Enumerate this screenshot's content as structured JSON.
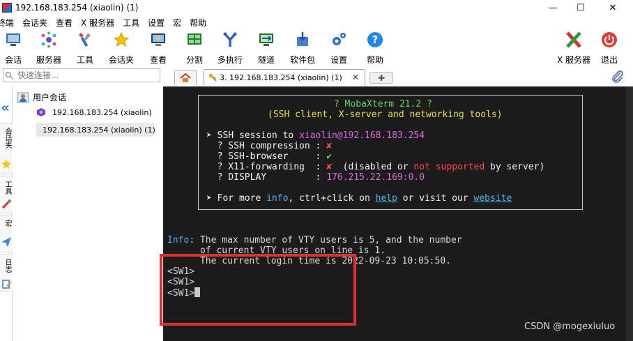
{
  "window": {
    "title": "192.168.183.254 (xiaolin) (1)",
    "minimize": "—",
    "maximize": "☐",
    "close": "✕"
  },
  "menu": [
    "终端",
    "会话夹",
    "查看",
    "X 服务器",
    "工具",
    "设置",
    "宏",
    "帮助"
  ],
  "toolbar": {
    "left": [
      {
        "label": "会话",
        "icon": "session-icon"
      },
      {
        "label": "服务器",
        "icon": "servers-icon"
      },
      {
        "label": "工具",
        "icon": "tools-icon"
      },
      {
        "label": "会话夹",
        "icon": "star-icon"
      },
      {
        "label": "查看",
        "icon": "view-icon"
      },
      {
        "label": "分割",
        "icon": "split-icon"
      },
      {
        "label": "多执行",
        "icon": "multiexec-icon"
      },
      {
        "label": "隧道",
        "icon": "tunnel-icon"
      },
      {
        "label": "软件包",
        "icon": "packages-icon"
      },
      {
        "label": "设置",
        "icon": "settings-icon"
      },
      {
        "label": "帮助",
        "icon": "help-icon"
      }
    ],
    "right": [
      {
        "label": "X 服务器",
        "icon": "x-server-icon"
      },
      {
        "label": "退出",
        "icon": "power-icon"
      }
    ]
  },
  "quick_connect": {
    "placeholder": "快速连接..."
  },
  "tabs": {
    "session_tab": "3. 192.168.183.254 (xiaolin) (1)",
    "close": "✕",
    "new_tab": "✚"
  },
  "sidebar": {
    "vertical_tabs": [
      "会话夹",
      "工具",
      "宏",
      "日志"
    ],
    "tree": {
      "root": "用户会话",
      "items": [
        "192.168.183.254 (xiaolin)",
        "192.168.183.254 (xiaolin) (1)"
      ]
    }
  },
  "terminal": {
    "banner": {
      "title": "? MobaXterm 21.2 ?",
      "subtitle": "(SSH client, X-server and networking tools)",
      "ssh_prefix": "➤ SSH session to ",
      "user": "xiaolin",
      "at_host": "@192.168.183.254",
      "compression_label": "  ? SSH compression : ",
      "compression_value": "✘",
      "browser_label": "  ? SSH-browser     : ",
      "browser_value": "✔",
      "x11_label": "  ? X11-forwarding  : ",
      "x11_value": "✘",
      "x11_note_open": "  (disabled or ",
      "x11_note_not_supported": "not supported",
      "x11_note_close": " by server)",
      "display_label": "  ? DISPLAY         : ",
      "display_value": "176.215.22.169:0.0",
      "more_prefix": "➤ For more ",
      "more_info": "info",
      "more_mid": ", ctrl+click on ",
      "more_help": "help",
      "more_mid2": " or visit our ",
      "more_website": "website"
    },
    "info_label": "Info",
    "info_line1": ": The max number of VTY users is 5, and the number",
    "info_line2": "      of current VTY users on line is 1.",
    "info_line3": "      The current login time is 2022-09-23 10:05:50.",
    "prompts": [
      "<SW1>",
      "<SW1>",
      "<SW1>"
    ]
  },
  "watermark": "CSDN @mogexiuluo",
  "colors": {
    "terminal_bg": "#1c1c1c",
    "highlight_box": "#e03131"
  }
}
